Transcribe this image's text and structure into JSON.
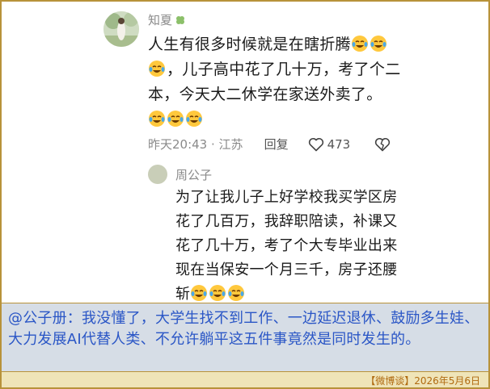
{
  "comment1": {
    "username": "知夏",
    "username_badge_icon": "clover-icon",
    "text_line1": "人生有很多时候就是在瞎折腾",
    "text_line2": "，儿子高中花了几十万，考了个二本，今天大二休学在家送外卖了。",
    "emoji_icon": "crying-laughing-emoji-icon",
    "timestamp": "昨天20:43",
    "location": "江苏",
    "reply_label": "回复",
    "like_count": "473"
  },
  "comment2": {
    "username": "周公子",
    "text": "为了让我儿子上好学校我买学区房花了几百万，我辞职陪读，补课又花了几十万，考了个大专毕业出来现在当保安一个月三千，房子还腰斩"
  },
  "caption": {
    "text": "@公子册：我没懂了，大学生找不到工作、一边延迟退休、鼓励多生娃、大力发展AI代替人类、不允许躺平这五件事竟然是同时发生的。"
  },
  "footer": {
    "text": "【微博谈】2026年5月6日"
  },
  "colors": {
    "border": "#b8923a",
    "caption_bg": "#d6dde6",
    "caption_text": "#2a56c6",
    "footer_bg": "#efe4b8",
    "footer_text": "#b06a10",
    "meta_text": "#8a8a8a"
  }
}
